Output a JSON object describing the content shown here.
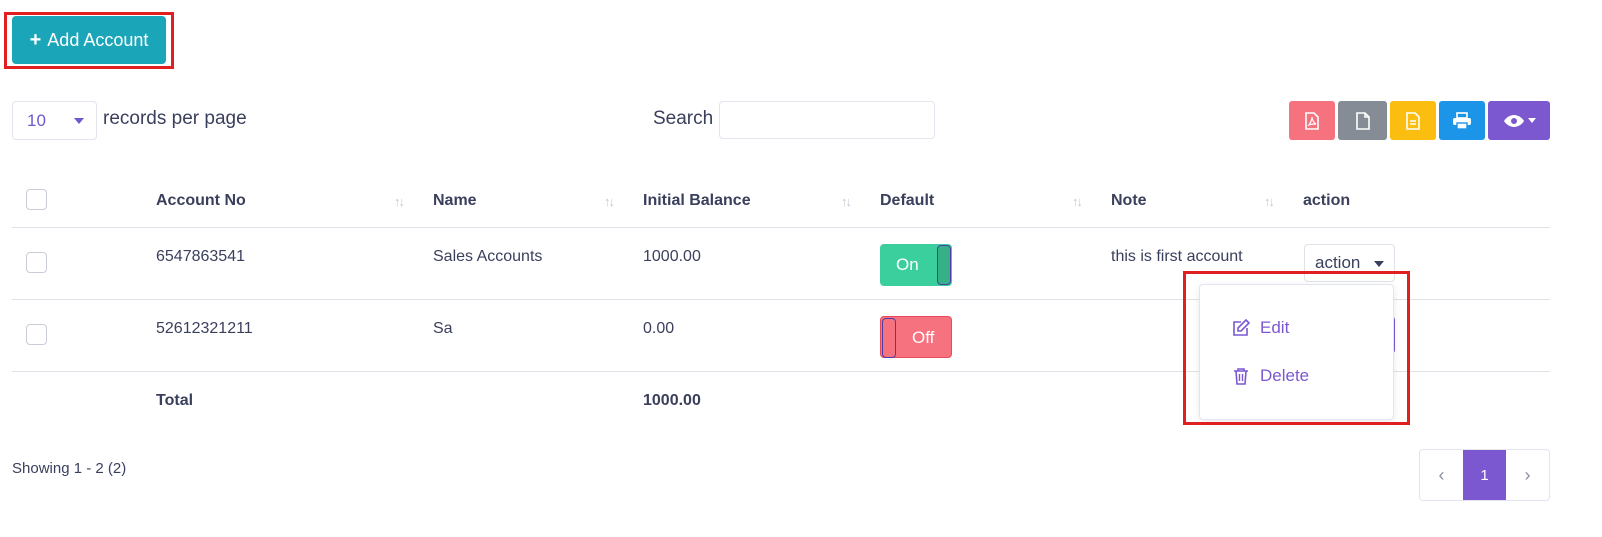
{
  "header": {
    "add_label": "Add Account",
    "add_icon": "plus-icon"
  },
  "controls": {
    "per_page_value": "10",
    "per_page_label": "records per page",
    "search_label": "Search",
    "search_value": ""
  },
  "toolbar": {
    "colors": {
      "pdf": "#f7727f",
      "doc": "#858c95",
      "excel": "#fbbd0f",
      "print": "#1c95e8",
      "view": "#7b58d0"
    }
  },
  "table": {
    "columns": [
      "Account No",
      "Name",
      "Initial Balance",
      "Default",
      "Note",
      "action"
    ],
    "rows": [
      {
        "account_no": "6547863541",
        "name": "Sales Accounts",
        "initial_balance": "1000.00",
        "default": "On",
        "note": "this is first account",
        "action": "action"
      },
      {
        "account_no": "52612321211",
        "name": "Sa",
        "initial_balance": "0.00",
        "default": "Off",
        "note": ""
      }
    ],
    "total_label": "Total",
    "total_value": "1000.00"
  },
  "action_menu": {
    "items": [
      {
        "label": "Edit",
        "icon": "edit-icon"
      },
      {
        "label": "Delete",
        "icon": "trash-icon"
      }
    ]
  },
  "footer": {
    "showing": "Showing 1 - 2 (2)",
    "current_page": "1"
  }
}
